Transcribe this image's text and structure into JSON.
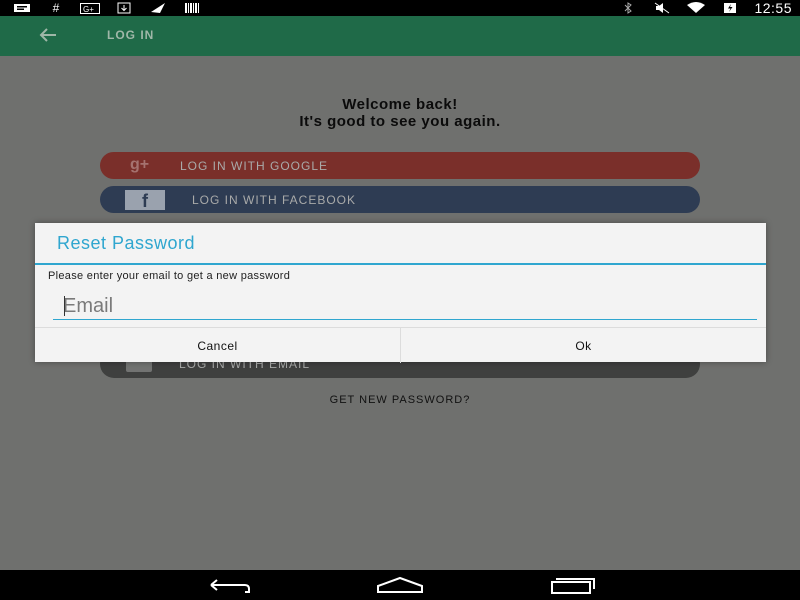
{
  "status_bar": {
    "time": "12:55",
    "icons_left": [
      "message-icon",
      "hash-icon",
      "google-plus-icon",
      "download-icon",
      "send-icon",
      "barcode-icon"
    ],
    "icons_right": [
      "bluetooth-icon",
      "mute-icon",
      "wifi-icon",
      "battery-icon"
    ]
  },
  "app_bar": {
    "title": "LOG IN"
  },
  "login": {
    "welcome_line1": "Welcome back!",
    "welcome_line2": "It's good to see you again.",
    "google_button": "LOG IN WITH GOOGLE",
    "google_icon_text": "g+",
    "facebook_button": "LOG IN WITH FACEBOOK",
    "facebook_icon_text": "f",
    "email_button": "LOG IN WITH EMAIL",
    "forgot_password": "GET NEW PASSWORD?"
  },
  "dialog": {
    "title": "Reset Password",
    "message": "Please enter your email to get a new password",
    "email_placeholder": "Email",
    "email_value": "",
    "cancel_label": "Cancel",
    "ok_label": "Ok"
  },
  "colors": {
    "accent": "#2fa6cf",
    "app_bar": "#1f6a48",
    "google": "#7a2f2a",
    "facebook": "#2e3c53"
  }
}
